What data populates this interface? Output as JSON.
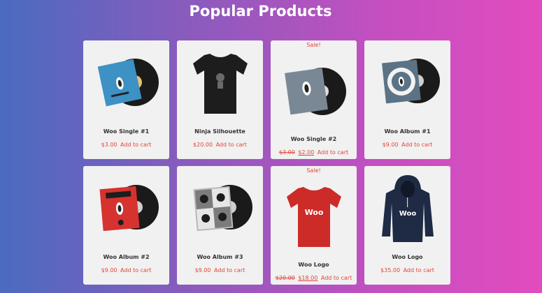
{
  "title": "Popular Products",
  "products": [
    {
      "name": "Woo Single #1",
      "price": "$3.00",
      "add": "Add to cart",
      "icon": "vinyl-single-blue"
    },
    {
      "name": "Ninja Silhouette",
      "price": "$20.00",
      "add": "Add to cart",
      "icon": "tshirt-black"
    },
    {
      "name": "Woo Single #2",
      "sale": "Sale!",
      "old_price": "$3.00",
      "price": "$2.00",
      "add": "Add to cart",
      "icon": "vinyl-single-grey"
    },
    {
      "name": "Woo Album #1",
      "price": "$9.00",
      "add": "Add to cart",
      "icon": "vinyl-album-1"
    },
    {
      "name": "Woo Album #2",
      "price": "$9.00",
      "add": "Add to cart",
      "icon": "vinyl-album-red"
    },
    {
      "name": "Woo Album #3",
      "price": "$9.00",
      "add": "Add to cart",
      "icon": "vinyl-album-grey"
    },
    {
      "name": "Woo Logo",
      "sale": "Sale!",
      "old_price": "$20.00",
      "price": "$18.00",
      "add": "Add to cart",
      "icon": "tshirt-red"
    },
    {
      "name": "Woo Logo",
      "price": "$35.00",
      "add": "Add to cart",
      "icon": "hoodie-navy"
    }
  ],
  "colors": {
    "accent": "#e0463a",
    "card_bg": "#f1f1f1"
  }
}
